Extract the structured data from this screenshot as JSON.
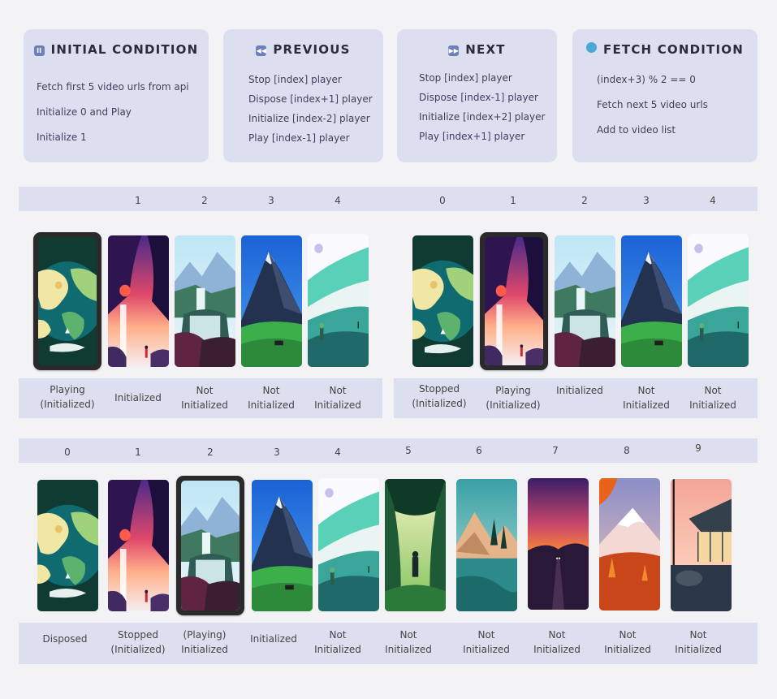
{
  "cards": [
    {
      "icon": "pause-icon",
      "glyph": "II",
      "title": "INITIAL CONDITION",
      "lines": [
        "Fetch first 5 video urls from api",
        "Initialize 0 and Play",
        "Initialize 1"
      ]
    },
    {
      "icon": "rewind-icon",
      "glyph": "◀◀",
      "title": "PREVIOUS",
      "lines": [
        "Stop [index] player",
        "Dispose [index+1] player",
        "Initialize [index-2] player",
        "Play [index-1] player"
      ]
    },
    {
      "icon": "fast-forward-icon",
      "glyph": "▶▶",
      "title": "NEXT",
      "lines": [
        "Stop [index] player",
        "Dispose [index-1] player",
        "Initialize [index+2] player",
        "Play [index+1] player"
      ]
    },
    {
      "icon": "globe-icon",
      "glyph": "",
      "title": "FETCH CONDITION",
      "lines": [
        "(index+3) % 2 == 0",
        "Fetch next 5 video urls",
        "Add to video list"
      ]
    }
  ],
  "diagrams": {
    "initial": {
      "indices": [
        "1",
        "2",
        "3",
        "4"
      ],
      "statuses": [
        "Playing\n(Initialized)",
        "Initialized",
        "Not\nInitialized",
        "Not\nInitialized",
        "Not\nInitialized"
      ]
    },
    "next": {
      "indices": [
        "0",
        "1",
        "2",
        "3",
        "4"
      ],
      "statuses": [
        "Stopped\n(Initialized)",
        "Playing\n(Initialized)",
        "Initialized",
        "Not\nInitialized",
        "Not\nInitialized"
      ]
    },
    "list": {
      "indices": [
        "0",
        "1",
        "2",
        "3",
        "4",
        "5",
        "6",
        "7",
        "8",
        "9"
      ],
      "statuses": [
        "Disposed",
        "Stopped\n(Initialized)",
        "(Playing)\nInitialized",
        "Initialized",
        "Not\nInitialized",
        "Not\nInitialized",
        "Not\nInitialized",
        "Not\nInitialized",
        "Not\nInitialized",
        "Not\nInitialized"
      ]
    }
  },
  "colors": {
    "card_bg": "#dcdff0",
    "page_bg": "#f3f3f5",
    "phone_frame": "#2a2a2a"
  }
}
